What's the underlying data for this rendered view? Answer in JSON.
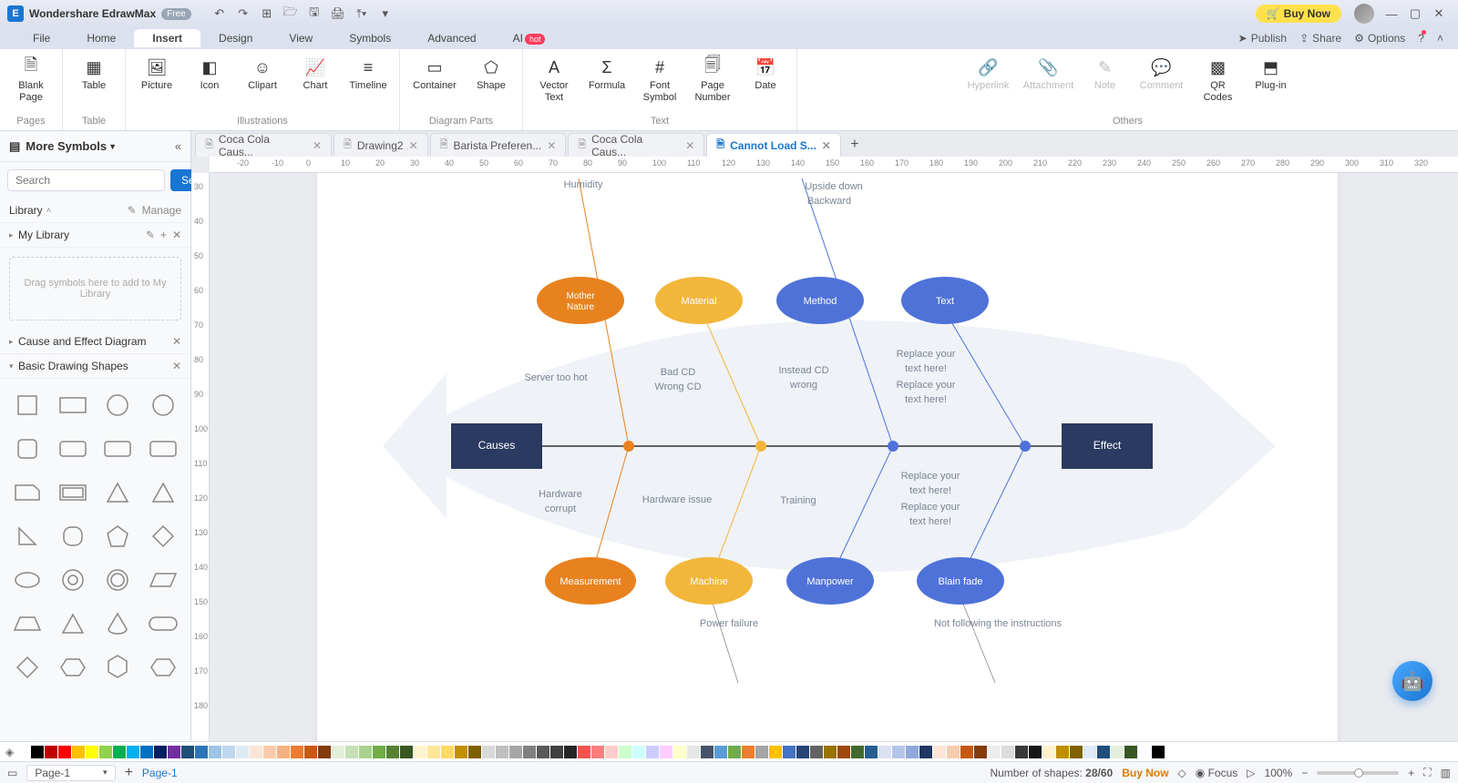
{
  "app": {
    "title": "Wondershare EdrawMax",
    "badge": "Free"
  },
  "titlebar_actions": {
    "buy": "Buy Now"
  },
  "menus": [
    "File",
    "Home",
    "Insert",
    "Design",
    "View",
    "Symbols",
    "Advanced",
    "AI"
  ],
  "active_menu": "Insert",
  "menu_right": {
    "publish": "Publish",
    "share": "Share",
    "options": "Options"
  },
  "ribbon": {
    "pages": {
      "blank": "Blank\nPage",
      "label": "Pages"
    },
    "table": {
      "table": "Table",
      "label": "Table"
    },
    "illustrations": {
      "picture": "Picture",
      "icon": "Icon",
      "clipart": "Clipart",
      "chart": "Chart",
      "timeline": "Timeline",
      "label": "Illustrations"
    },
    "diagram": {
      "container": "Container",
      "shape": "Shape",
      "label": "Diagram Parts"
    },
    "text": {
      "vector": "Vector\nText",
      "formula": "Formula",
      "font": "Font\nSymbol",
      "pageno": "Page\nNumber",
      "date": "Date",
      "label": "Text"
    },
    "others": {
      "hyperlink": "Hyperlink",
      "attachment": "Attachment",
      "note": "Note",
      "comment": "Comment",
      "qr": "QR\nCodes",
      "plugin": "Plug-in",
      "label": "Others"
    }
  },
  "sidebar": {
    "header": "More Symbols",
    "search_placeholder": "Search",
    "search_btn": "Search",
    "library": "Library",
    "manage": "Manage",
    "mylib": "My Library",
    "dropzone": "Drag symbols here to add to My Library",
    "group_cause": "Cause and Effect Diagram",
    "group_basic": "Basic Drawing Shapes"
  },
  "tabs": [
    {
      "label": "Coca Cola Caus...",
      "active": false
    },
    {
      "label": "Drawing2",
      "active": false
    },
    {
      "label": "Barista Preferen...",
      "active": false
    },
    {
      "label": "Coca Cola Caus...",
      "active": false
    },
    {
      "label": "Cannot Load S...",
      "active": true
    }
  ],
  "diagram": {
    "spine_left": "Causes",
    "spine_right": "Effect",
    "top_categories": [
      {
        "label": "Mother Nature",
        "color": "#e8821e"
      },
      {
        "label": "Material",
        "color": "#f2b63a"
      },
      {
        "label": "Method",
        "color": "#4f72d9"
      },
      {
        "label": "Text",
        "color": "#4f72d9"
      }
    ],
    "bottom_categories": [
      {
        "label": "Measurement",
        "color": "#e8821e"
      },
      {
        "label": "Machine",
        "color": "#f2b63a"
      },
      {
        "label": "Manpower",
        "color": "#4f72d9"
      },
      {
        "label": "Blain fade",
        "color": "#4f72d9"
      }
    ],
    "top_texts": {
      "humidity": "Humidity",
      "srv": "Server too hot",
      "badcd": "Bad CD",
      "wrongcd": "Wrong CD",
      "insteadcd": "Instead CD",
      "wrong": "wrong",
      "rt1": "Replace your",
      "rt2": "text here!",
      "rt3": "Replace your",
      "rt4": "text here!",
      "upside": "Upside down",
      "backward": "Backward"
    },
    "bottom_texts": {
      "hw1": "Hardware",
      "hw2": "corrupt",
      "hwissue": "Hardware issue",
      "training": "Training",
      "rb1": "Replace your",
      "rb2": "text here!",
      "rb3": "Replace your",
      "rb4": "text here!",
      "power": "Power failure",
      "notfollow": "Not following the instructions"
    }
  },
  "ruler_ticks": [
    -20,
    -10,
    0,
    10,
    20,
    30,
    40,
    50,
    60,
    70,
    80,
    90,
    100,
    110,
    120,
    130,
    140,
    150,
    160,
    170,
    180,
    190,
    200,
    210,
    220,
    230,
    240,
    250,
    260,
    270,
    280,
    290,
    300,
    310,
    320
  ],
  "ruler_v": [
    30,
    40,
    50,
    60,
    70,
    80,
    90,
    100,
    110,
    120,
    130,
    140,
    150,
    160,
    170,
    180
  ],
  "status": {
    "page_sel": "Page-1",
    "page_tab": "Page-1",
    "shapes_label": "Number of shapes:",
    "shapes_val": "28/60",
    "buy": "Buy Now",
    "focus": "Focus",
    "zoom": "100%"
  },
  "colors": [
    "#ffffff",
    "#000000",
    "#c00000",
    "#ff0000",
    "#ffc000",
    "#ffff00",
    "#92d050",
    "#00b050",
    "#00b0f0",
    "#0070c0",
    "#002060",
    "#7030a0",
    "#1f4e79",
    "#2e75b6",
    "#9dc3e6",
    "#bdd7ee",
    "#deebf7",
    "#fbe5d6",
    "#f8cbad",
    "#f4b183",
    "#ed7d31",
    "#c55a11",
    "#843c0c",
    "#e2f0d9",
    "#c5e0b4",
    "#a9d18e",
    "#70ad47",
    "#548235",
    "#385723",
    "#fff2cc",
    "#ffe699",
    "#ffd966",
    "#bf9000",
    "#7f6000",
    "#d9d9d9",
    "#bfbfbf",
    "#a6a6a6",
    "#808080",
    "#595959",
    "#404040",
    "#262626",
    "#ff5050",
    "#ff7c80",
    "#ffcccc",
    "#ccffcc",
    "#ccffff",
    "#ccccff",
    "#ffccff",
    "#ffffcc",
    "#e7e6e6",
    "#44546a",
    "#5b9bd5",
    "#70ad47",
    "#ed7d31",
    "#a5a5a5",
    "#ffc000",
    "#4472c4",
    "#264478",
    "#636363",
    "#997300",
    "#9e480e",
    "#43682b",
    "#255e91",
    "#d9e1f2",
    "#b4c6e7",
    "#8ea9db",
    "#203764",
    "#fce4d6",
    "#f8cbad",
    "#c65911",
    "#833c0c",
    "#ededed",
    "#dbdbdb",
    "#3a3838",
    "#161616",
    "#fff2cc",
    "#bf8f00",
    "#806000",
    "#ddebf7",
    "#1f4e78",
    "#e2efda",
    "#375623",
    "#ffffff",
    "#000000"
  ]
}
